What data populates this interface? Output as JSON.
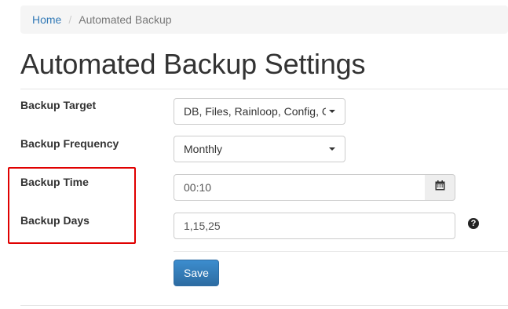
{
  "breadcrumb": {
    "home": "Home",
    "separator": "/",
    "current": "Automated Backup"
  },
  "page": {
    "title": "Automated Backup Settings"
  },
  "form": {
    "backup_target": {
      "label": "Backup Target",
      "value": "DB, Files, Rainloop, Config, C"
    },
    "backup_frequency": {
      "label": "Backup Frequency",
      "value": "Monthly"
    },
    "backup_time": {
      "label": "Backup Time",
      "value": "00:10",
      "icon": "calendar-icon"
    },
    "backup_days": {
      "label": "Backup Days",
      "value": "1,15,25",
      "help_icon": "question-circle-icon",
      "help_glyph": "?"
    },
    "save_label": "Save"
  },
  "colors": {
    "link": "#337ab7",
    "primary_button": "#337ab7",
    "highlight": "#e00000"
  }
}
